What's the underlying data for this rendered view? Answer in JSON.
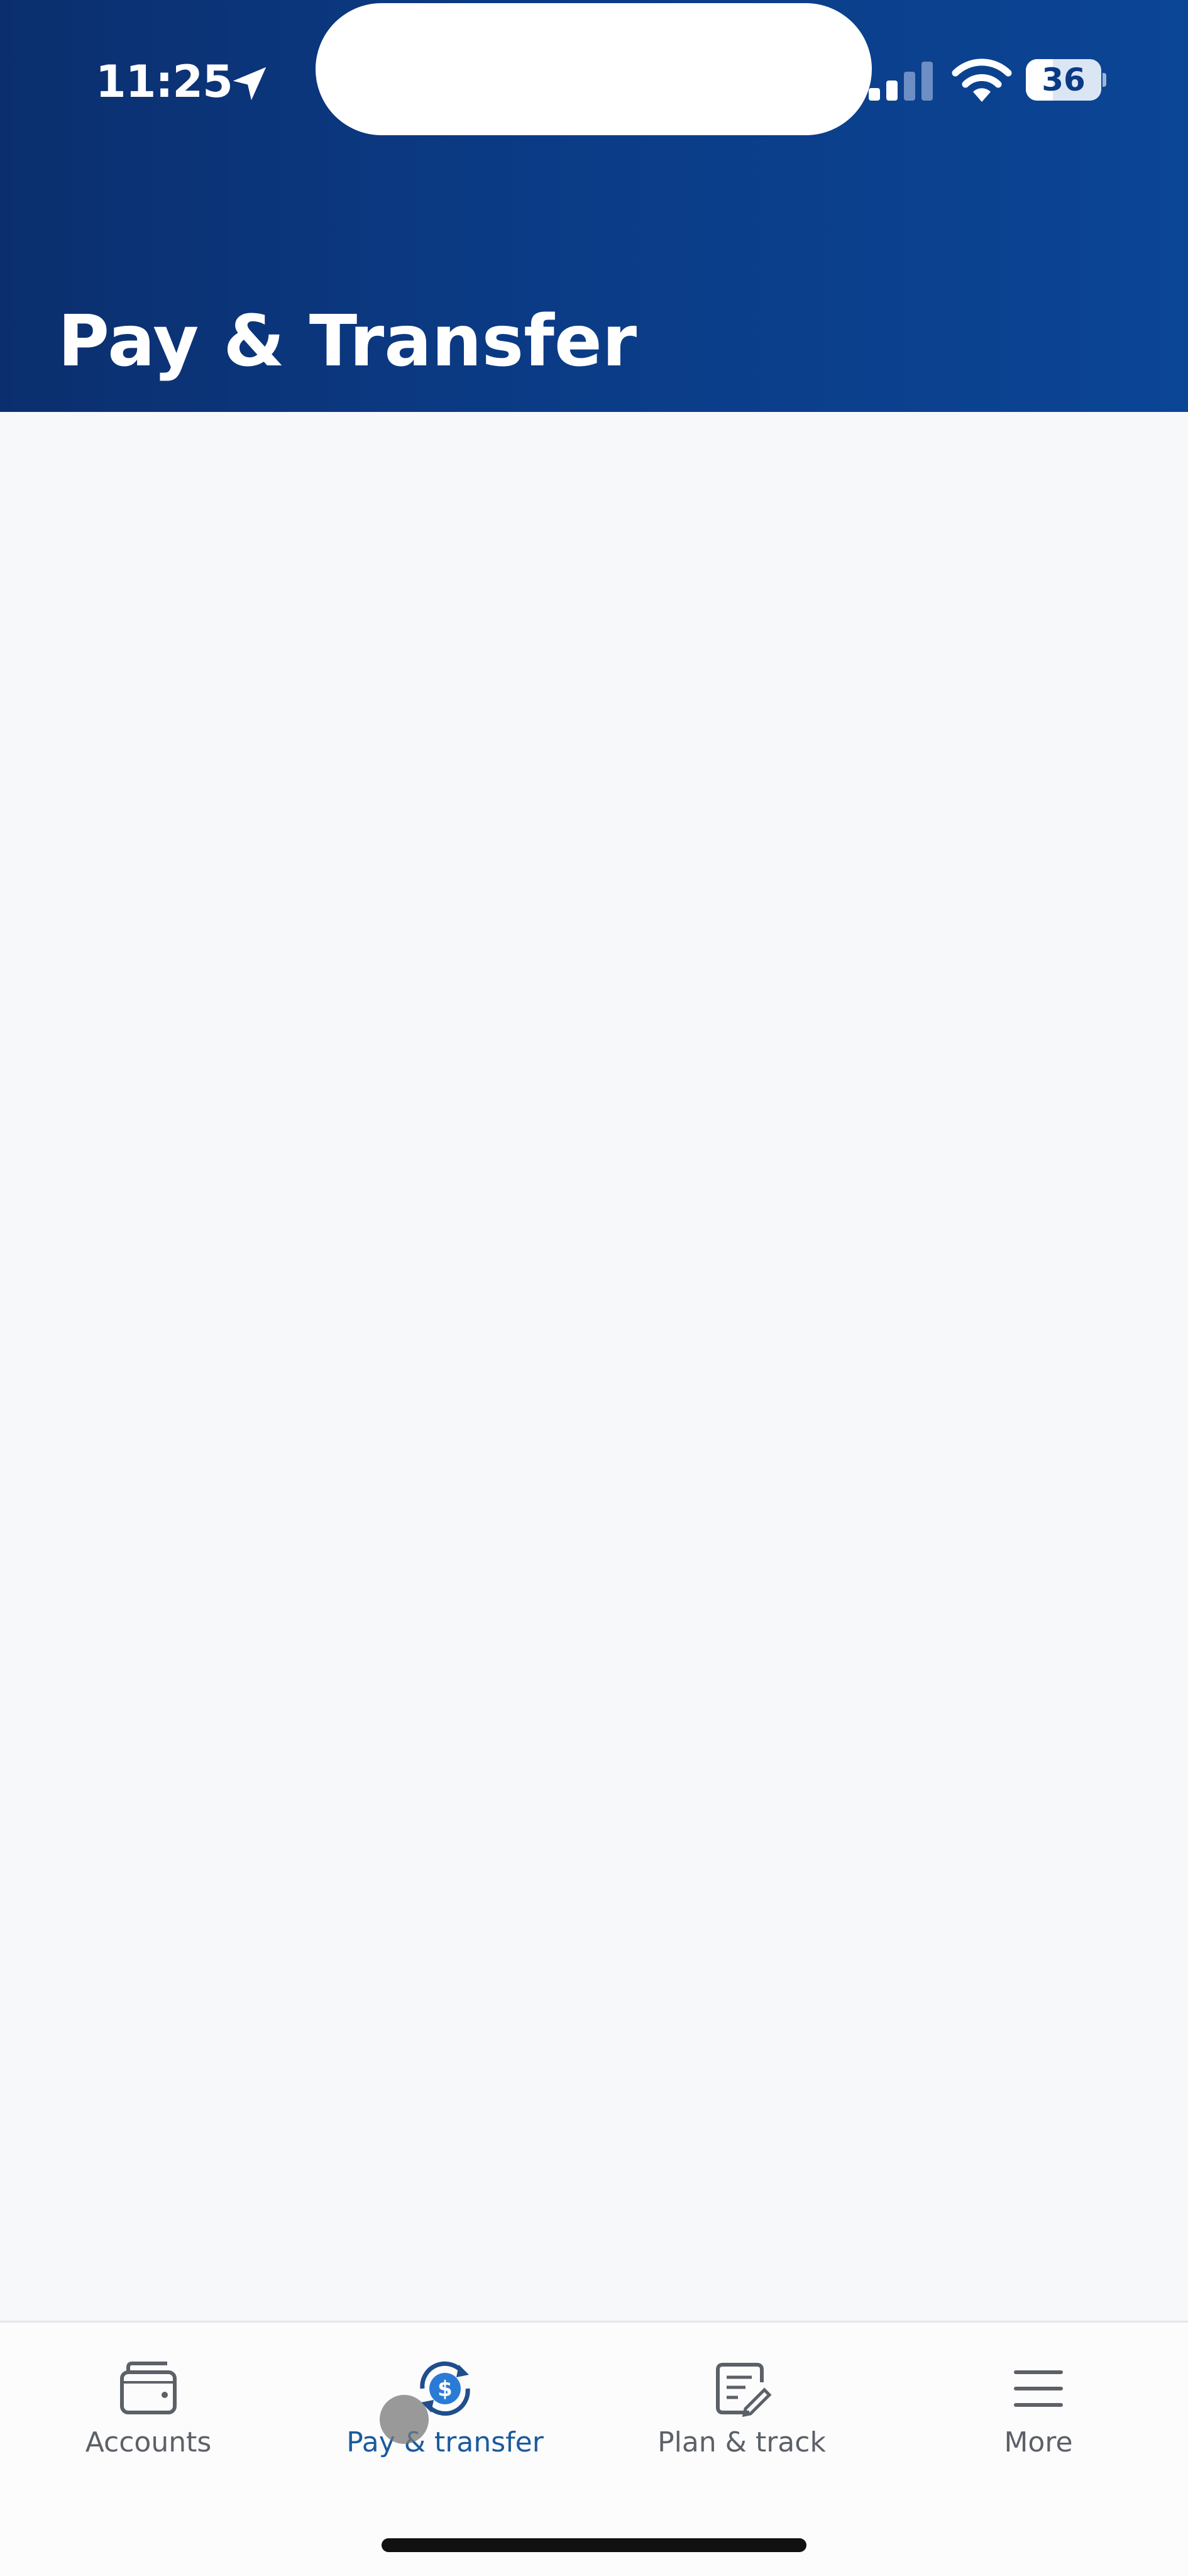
{
  "status_bar": {
    "time": "11:25",
    "battery_level": "36",
    "battery_fraction": 0.36
  },
  "header": {
    "title": "Pay & Transfer"
  },
  "tab_bar": {
    "tabs": [
      {
        "label": "Accounts",
        "icon": "wallet-icon",
        "active": false
      },
      {
        "label": "Pay & transfer",
        "icon": "dollar-refresh-icon",
        "active": true
      },
      {
        "label": "Plan & track",
        "icon": "notepad-pencil-icon",
        "active": false
      },
      {
        "label": "More",
        "icon": "hamburger-menu-icon",
        "active": false
      }
    ]
  },
  "colors": {
    "header_dark": "#0b2f6e",
    "header_light": "#0b4595",
    "background": "#f7f8fa",
    "tab_active": "#1a5a9c",
    "tab_inactive": "#5c6168"
  }
}
